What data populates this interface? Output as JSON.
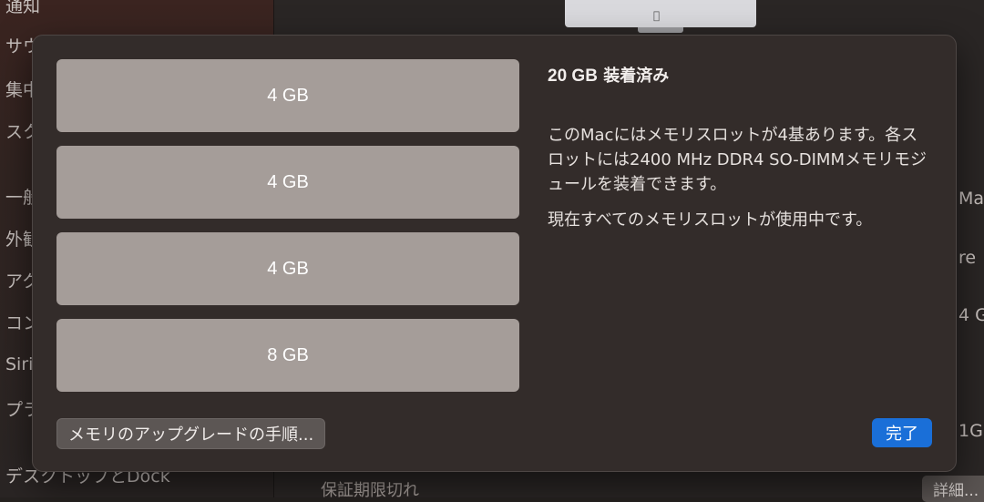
{
  "background": {
    "sidebar_items": [
      "通知",
      "サウ",
      "集中",
      "スク",
      "一般",
      "外観",
      "アク",
      "コン",
      "Siri",
      "プラ",
      "デスクトップとDock"
    ],
    "right_fragments": [
      "Ma",
      "re",
      "4 G",
      "1G"
    ],
    "warranty_label": "保証期限切れ",
    "details_button": "詳細..."
  },
  "dialog": {
    "slots": [
      {
        "label": "4 GB"
      },
      {
        "label": "4 GB"
      },
      {
        "label": "4 GB"
      },
      {
        "label": "8 GB"
      }
    ],
    "title_amount": "20 GB",
    "title_suffix": "装着済み",
    "description": "このMacにはメモリスロットが4基あります。各スロットには2400 MHz DDR4 SO-DIMMメモリモジュールを装着できます。",
    "status": "現在すべてのメモリスロットが使用中です。",
    "upgrade_button": "メモリのアップグレードの手順...",
    "done_button": "完了"
  },
  "colors": {
    "accent": "#1a6fd8",
    "slot_fill": "#a59d99",
    "sheet_bg": "#332c2a"
  }
}
